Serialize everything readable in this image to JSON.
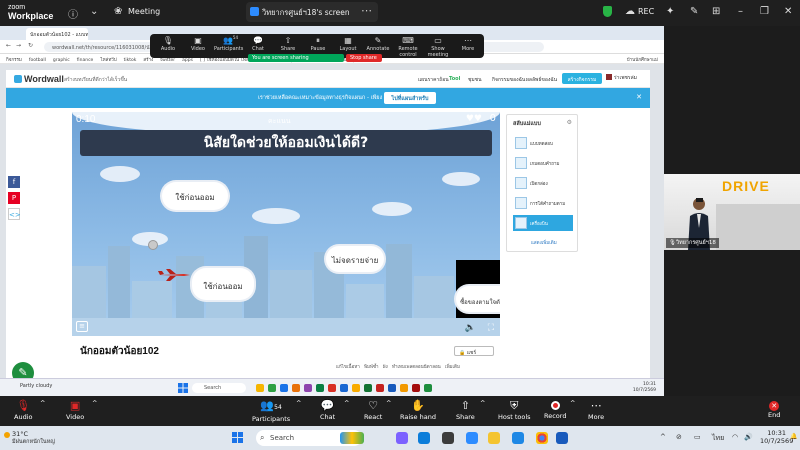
{
  "zoom": {
    "logo_line1": "zoom",
    "logo_line2": "Workplace",
    "meeting_label": "Meeting",
    "screen_tab_title": "วิทยากรศูนย์ฯ18's screen",
    "rec_label": "REC"
  },
  "share_toolbar": {
    "items": [
      "Audio",
      "Video",
      "Participants",
      "Chat",
      "Share",
      "Pause",
      "Layout",
      "Annotate",
      "Remote control",
      "Show meeting",
      "More"
    ],
    "participants_count": "54",
    "sharing_label": "You are screen sharing",
    "stop_label": "Stop share"
  },
  "browser": {
    "tab_title": "นักออมตัวน้อย102 - แบบทดสอบ",
    "url": "wordwall.net/th/resource/116031008/นักออมตัวน้อย102",
    "bookmarks": [
      "กิจกรรม",
      "football",
      "graphic",
      "finance",
      "ไหล่ทวีป",
      "tiktok",
      "สร้าง",
      "twitter",
      "apps",
      "[ ] ใช้ห้องแอบมืดใน ไฟล์...",
      "[ ] Zoom-ประชุม OBE...",
      "สารบบคอนเทน กลุ่มท์..."
    ],
    "right_bookmark": "บ้านนักศึกษาแม่"
  },
  "wordwall": {
    "logo": "Wordwall",
    "tagline": "สร้างบทเรียนที่ดีกว่าได้เร็วขึ้น",
    "nav": [
      "แผนราคาถ้อน",
      "ชุมชน",
      "กิจกรรมของฉัน",
      "ผลลัพธ์ของฉัน"
    ],
    "nav_badge": "Tool",
    "create_btn": "สร้างกิจกรรม",
    "user": "ร่าเพชรล่ม",
    "banner_text": "เราช่วยเหลือคณะเหมาะข้อมูลทางธุรกิจแผนก - เพียง 3 ค่าเตรียมพื้น ฯ !",
    "banner_btn": "ไปที่แผนสำหรับ",
    "activity_title": "นักออมตัวน้อย102",
    "share_btn": "แชร์",
    "actions": [
      "แก้ไขเนื้อหา",
      "พิมพ์ซ้ำ",
      "ฝัง",
      "ทำเทมเพลตลอนนีดาลอน",
      "เพิ่มเติม"
    ],
    "templates_heading": "สลับแม่แบบ",
    "templates": [
      "แบบทดสอบ",
      "เกมตอบคำถาม",
      "เปิดกล่อง",
      "การโต้คำถามตาม",
      "เครื่องบิน"
    ],
    "templates_more": "แสดงเพิ่มเติม"
  },
  "game": {
    "timer": "0:10",
    "score_label": "คะแนน",
    "lives": "0",
    "question": "นิสัยใดช่วยให้ออมเงินได้ดี?",
    "answers": [
      {
        "text": "ใช้ก่อนออม"
      },
      {
        "text": "ไม่จดรายจ่าย"
      },
      {
        "text": "ใช้ก่อนออม"
      },
      {
        "text": "ซื้อของตามใจตัวเอง"
      }
    ]
  },
  "inner_taskbar": {
    "search": "Search",
    "weather": "Partly cloudy",
    "time": "10:31",
    "date": "10/7/2569"
  },
  "gallery": {
    "banner": "DRIVE",
    "name": "วิทยากรศูนย์ฯ18"
  },
  "bottom_toolbar": {
    "audio": "Audio",
    "video": "Video",
    "participants": "Participants",
    "participants_count": "54",
    "chat": "Chat",
    "react": "React",
    "raise_hand": "Raise hand",
    "share": "Share",
    "host_tools": "Host tools",
    "record": "Record",
    "more": "More",
    "end": "End"
  },
  "taskbar": {
    "temp": "31°C",
    "weather": "มีฝนตกหนักในหญ่",
    "search": "Search",
    "lang": "ไทย",
    "time": "10:31",
    "date": "10/7/2569"
  }
}
